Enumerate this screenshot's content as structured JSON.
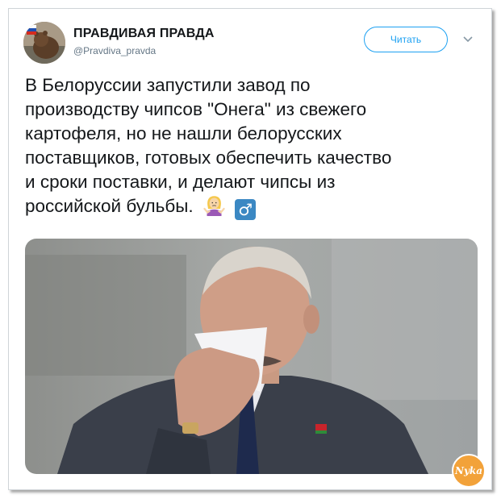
{
  "tweet": {
    "author_name": "ПРАВДИВАЯ ПРАВДА",
    "author_handle": "@Pravdiva_pravda",
    "follow_label": "Читать",
    "text_lines": [
      "В Белоруссии запустили завод по",
      "производству чипсов \"Онега\" из свежего",
      "картофеля, но не нашли белорусских",
      "поставщиков, готовых обеспечить качество",
      "и сроки поставки, и делают чипсы из",
      "российской бульбы."
    ],
    "male_sign": "♂",
    "emoji_names": [
      "person-shrugging-icon",
      "male-sign-icon"
    ]
  },
  "watermark": {
    "text": "Nyka"
  },
  "colors": {
    "accent": "#1da1f2",
    "handle": "#657786",
    "text": "#14171a",
    "male_badge": "#3b88c3",
    "watermark": "#f2a23a"
  }
}
